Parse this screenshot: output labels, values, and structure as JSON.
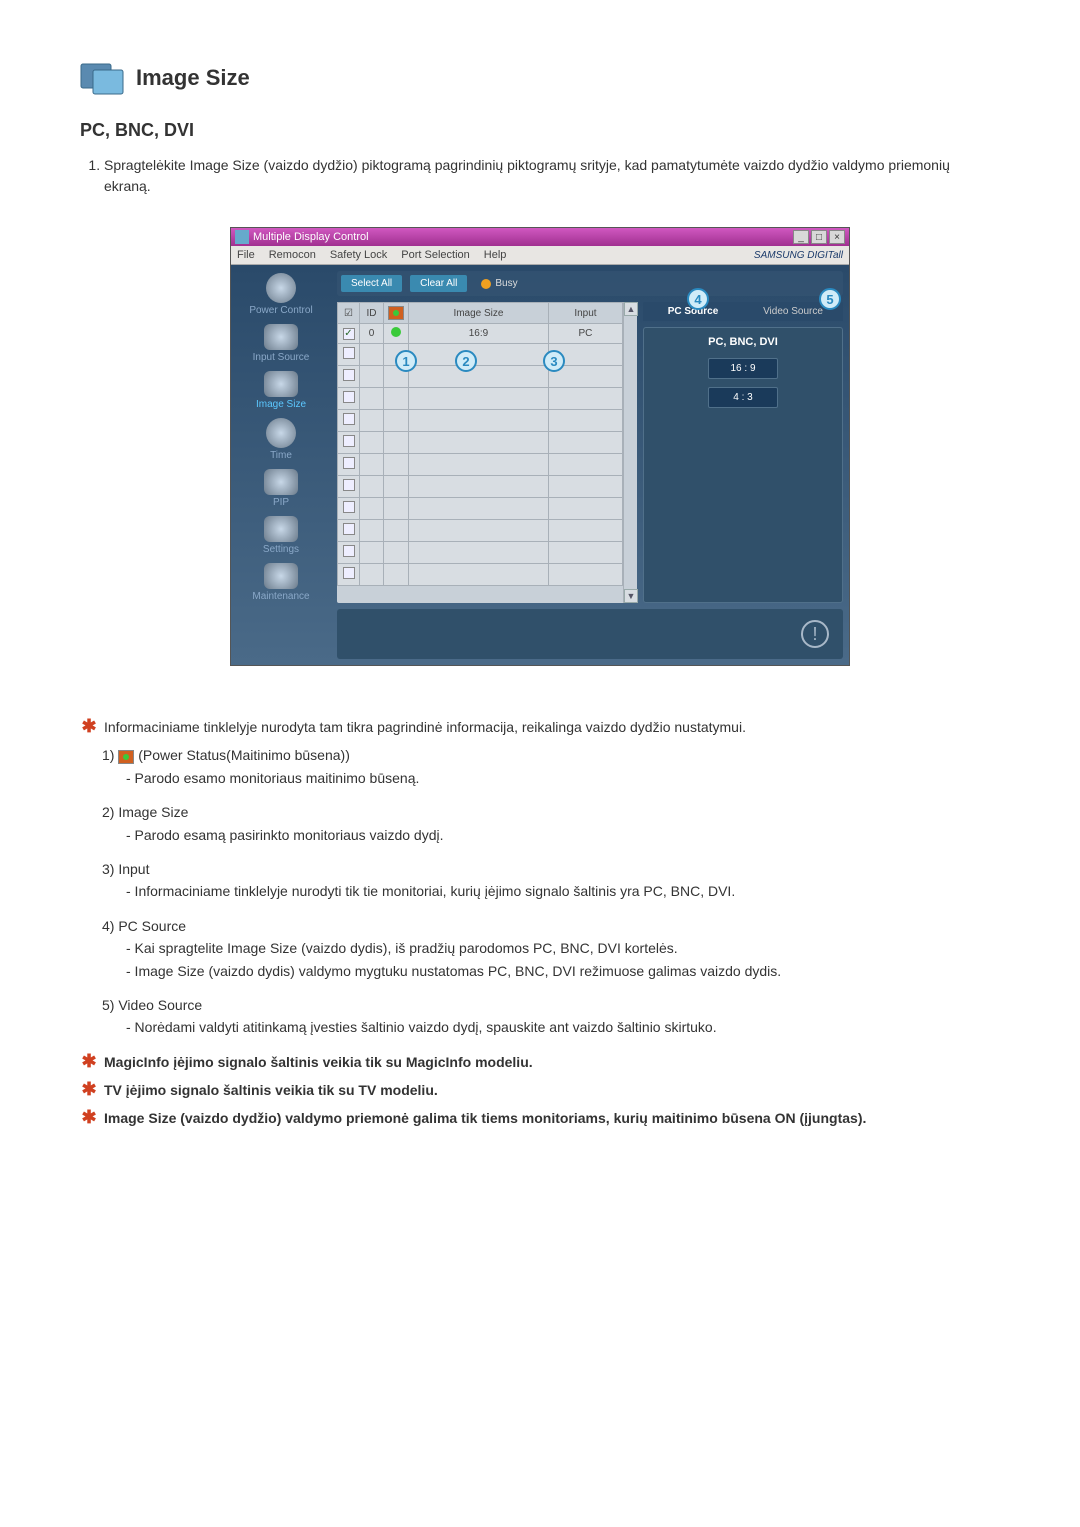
{
  "header": {
    "title": "Image Size"
  },
  "subtitle": "PC, BNC, DVI",
  "instructions": [
    "Spragtelėkite Image Size (vaizdo dydžio) piktogramą pagrindinių piktogramų srityje, kad pamatytumėte vaizdo dydžio valdymo priemonių ekraną."
  ],
  "app": {
    "window_title": "Multiple Display Control",
    "brand": "SAMSUNG DIGITall",
    "win_controls": {
      "min": "_",
      "max": "□",
      "close": "×"
    },
    "menu": [
      "File",
      "Remocon",
      "Safety Lock",
      "Port Selection",
      "Help"
    ],
    "sidebar": [
      {
        "label": "Power Control",
        "selected": false
      },
      {
        "label": "Input Source",
        "selected": false
      },
      {
        "label": "Image Size",
        "selected": true
      },
      {
        "label": "Time",
        "selected": false
      },
      {
        "label": "PIP",
        "selected": false
      },
      {
        "label": "Settings",
        "selected": false
      },
      {
        "label": "Maintenance",
        "selected": false
      }
    ],
    "buttons": {
      "select_all": "Select All",
      "clear_all": "Clear All"
    },
    "busy_label": "Busy",
    "table": {
      "headers": {
        "check": "☑",
        "id": "ID",
        "status": "",
        "image_size": "Image Size",
        "input": "Input"
      },
      "row": {
        "id": "0",
        "image_size": "16:9",
        "input": "PC"
      }
    },
    "right": {
      "tab_pc": "PC Source",
      "tab_video": "Video Source",
      "panel_label": "PC, BNC, DVI",
      "opt1": "16 : 9",
      "opt2": "4 : 3"
    },
    "warn": "!"
  },
  "legend": {
    "intro": "Informaciniame tinklelyje nurodyta tam tikra pagrindinė informacija, reikalinga vaizdo dydžio nustatymui.",
    "items": [
      {
        "num": "1)",
        "label_after_icon": "(Power Status(Maitinimo būsena))",
        "lines": [
          "- Parodo esamo monitoriaus maitinimo būseną."
        ]
      },
      {
        "num": "2)",
        "label": "Image Size",
        "lines": [
          "- Parodo esamą pasirinkto monitoriaus vaizdo dydį."
        ]
      },
      {
        "num": "3)",
        "label": "Input",
        "lines": [
          "- Informaciniame tinklelyje nurodyti tik tie monitoriai, kurių įėjimo signalo šaltinis yra PC, BNC, DVI."
        ]
      },
      {
        "num": "4)",
        "label": "PC Source",
        "lines": [
          "- Kai spragtelite Image Size (vaizdo dydis), iš pradžių parodomos PC, BNC, DVI kortelės.",
          "- Image Size (vaizdo dydis) valdymo mygtuku nustatomas PC, BNC, DVI režimuose galimas vaizdo dydis."
        ]
      },
      {
        "num": "5)",
        "label": "Video Source",
        "lines": [
          "- Norėdami valdyti atitinkamą įvesties šaltinio vaizdo dydį, spauskite ant vaizdo šaltinio skirtuko."
        ]
      }
    ],
    "notes": [
      "MagicInfo įėjimo signalo šaltinis veikia tik su MagicInfo modeliu.",
      "TV įėjimo signalo šaltinis veikia tik su TV modeliu.",
      "Image Size (vaizdo dydžio) valdymo priemonė galima tik tiems monitoriams, kurių maitinimo būsena ON (įjungtas)."
    ]
  }
}
